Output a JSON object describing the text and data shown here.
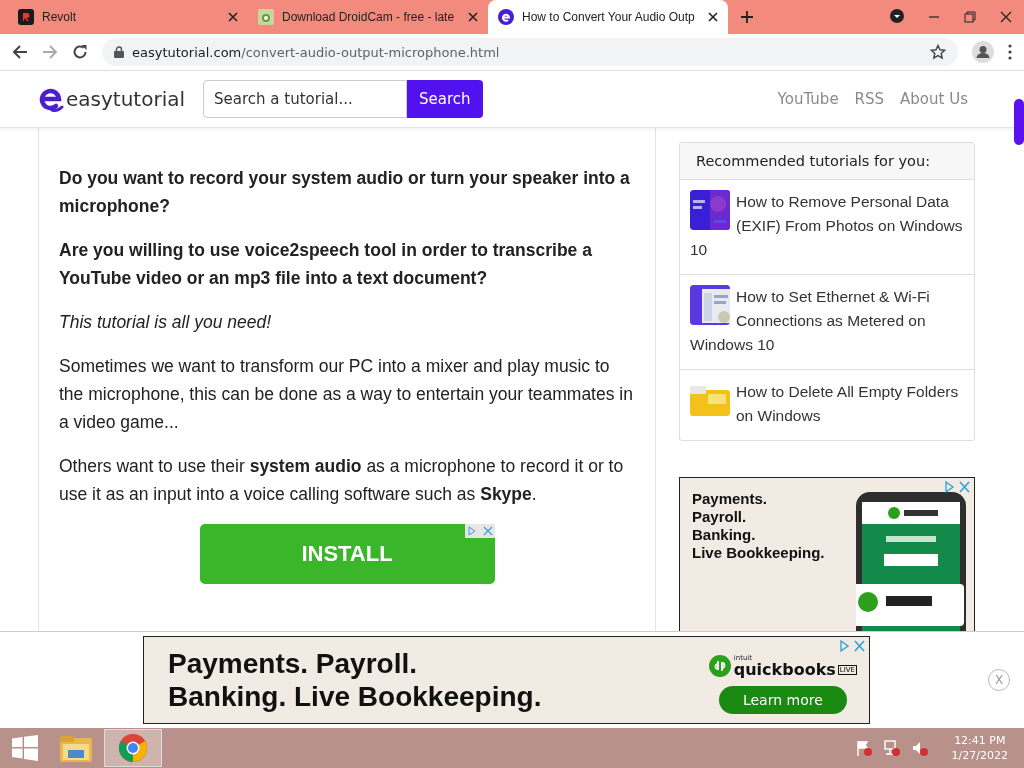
{
  "browser": {
    "tabs": [
      {
        "kind": "revolt",
        "title": "Revolt",
        "selected": false
      },
      {
        "kind": "droidcam",
        "title": "Download DroidCam - free - late",
        "selected": false
      },
      {
        "kind": "easytutorial",
        "title": "How to Convert Your Audio Outp",
        "selected": true
      }
    ],
    "address": {
      "domain": "easytutorial.com",
      "path": "/convert-audio-output-microphone.html"
    }
  },
  "site_header": {
    "logo": "easytutorial",
    "search": {
      "placeholder": "Search a tutorial...",
      "button": "Search"
    },
    "nav": [
      "YouTube",
      "RSS",
      "About Us"
    ]
  },
  "article": {
    "paragraphs": [
      {
        "kind": "bold",
        "text": "Do you want to record your system audio or turn your speaker into a microphone?"
      },
      {
        "kind": "bold",
        "text": "Are you willing to use voice2speech tool in order to transcribe a YouTube video or an mp3 file into a text document?"
      },
      {
        "kind": "italic",
        "text": "This tutorial is all you need!"
      },
      {
        "kind": "plain",
        "text": "Sometimes we want to transform our PC into a mixer and play music to the microphone, this can be done as a way to entertain your teammates in a video game..."
      },
      {
        "kind": "plain",
        "text": "Others want to use their **system audio** as a microphone to record it or to use it as an input into a voice calling software such as **Skype**."
      }
    ],
    "ad_button": "INSTALL"
  },
  "sidebar": {
    "title": "Recommended tutorials for you:",
    "items": [
      {
        "title": "How to Remove Personal Data (EXIF) From Photos on Windows 10",
        "kind": "picture"
      },
      {
        "title": "How to Set Ethernet & Wi-Fi Connections as Metered on Windows 10",
        "kind": "picture"
      },
      {
        "title": "How to Delete All Empty Folders on Windows",
        "kind": "picture"
      }
    ]
  },
  "side_ad": {
    "lines": [
      "Payments.",
      "Payroll.",
      "Banking.",
      "Live Bookkeeping."
    ]
  },
  "bottom_ad": {
    "lines": [
      "Payments. Payroll.",
      "Banking. Live Bookkeeping."
    ],
    "brand_top": "intuit",
    "brand": "quickbooks",
    "brand_badge": "LIVE",
    "button": "Learn more",
    "close": "X"
  },
  "taskbar": {
    "time": "12:41 PM",
    "date": "1/27/2022"
  }
}
